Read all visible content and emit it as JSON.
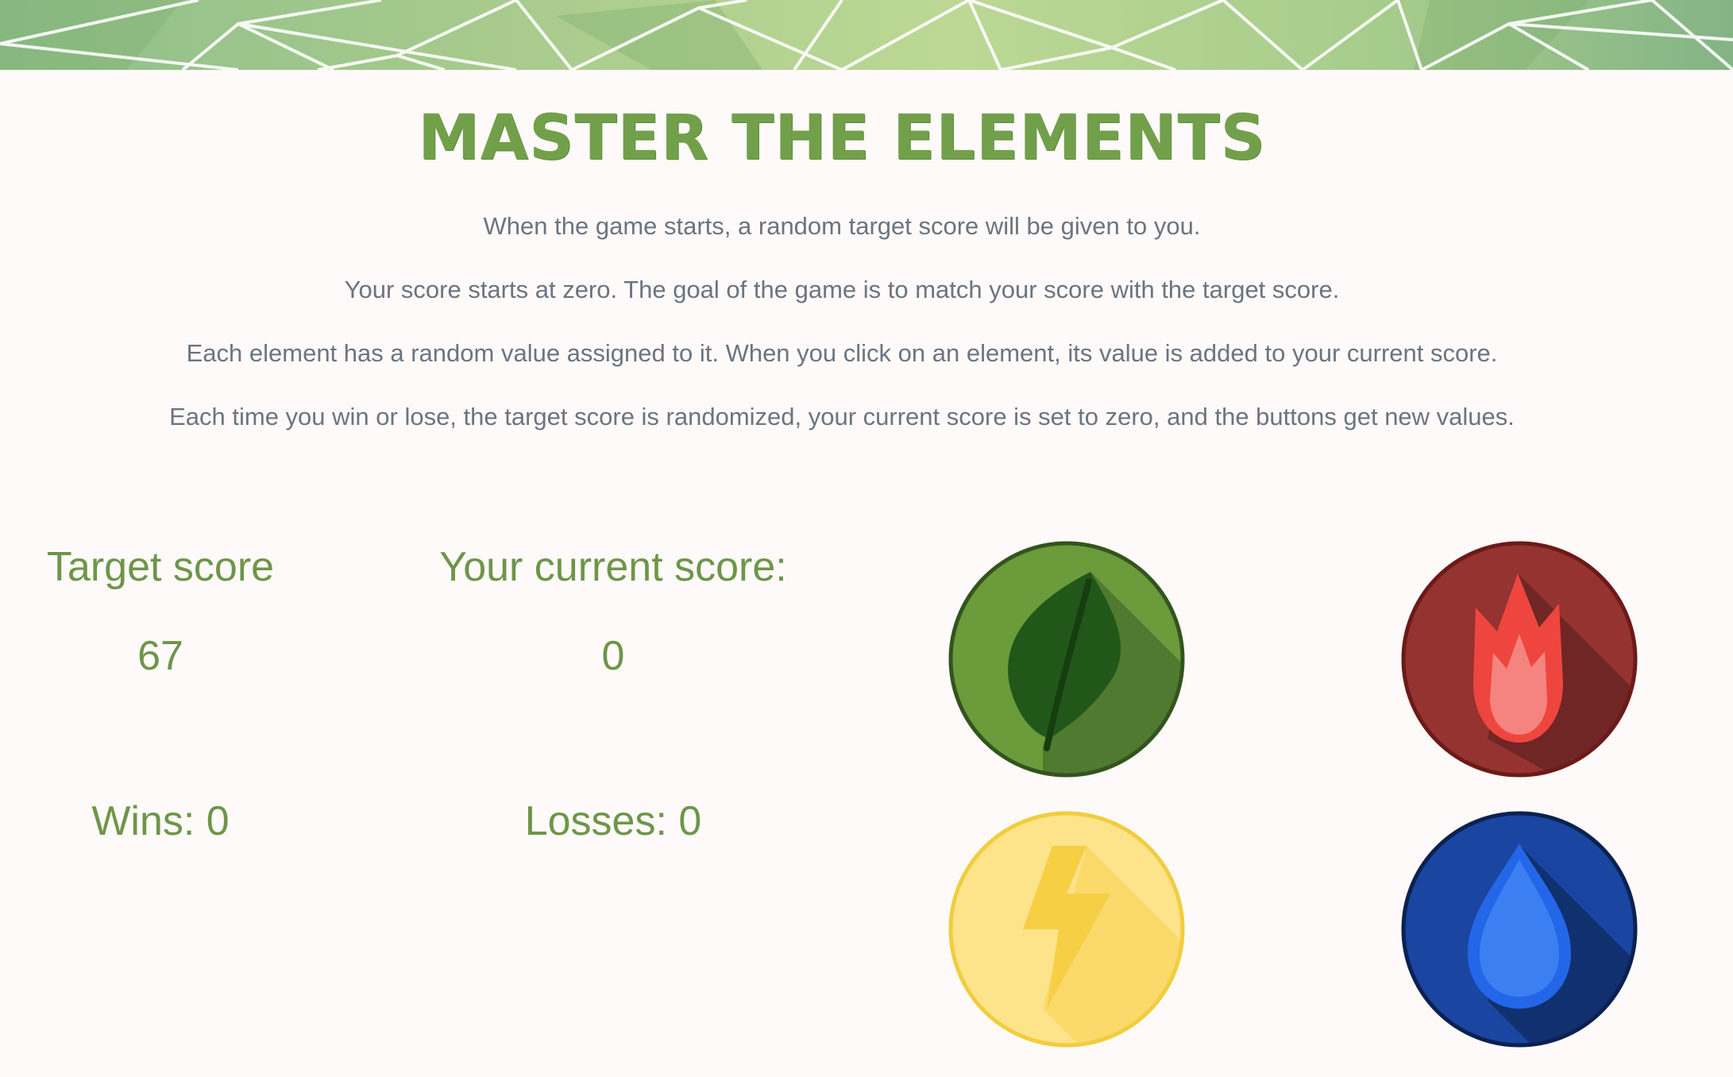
{
  "header": {
    "title": "MASTER THE ELEMENTS"
  },
  "instructions": [
    "When the game starts, a random target score will be given to you.",
    "Your score starts at zero. The goal of the game is to match your score with the target score.",
    "Each element has a random value assigned to it. When you click on an element, its value is added to your current score.",
    "Each time you win or lose, the target score is randomized, your current score is set to zero, and the buttons get new values."
  ],
  "scoreboard": {
    "target_label": "Target score",
    "target_value": "67",
    "current_label": "Your current score:",
    "current_value": "0",
    "wins_text": "Wins: 0",
    "losses_text": "Losses: 0"
  },
  "elements": [
    {
      "name": "earth",
      "icon": "leaf-icon",
      "color": "#6b9b3a"
    },
    {
      "name": "fire",
      "icon": "flame-icon",
      "color": "#943330"
    },
    {
      "name": "lightning",
      "icon": "lightning-bolt-icon",
      "color": "#fde38a"
    },
    {
      "name": "water",
      "icon": "water-drop-icon",
      "color": "#1a45a0"
    }
  ],
  "colors": {
    "accent_green": "#72a04a",
    "text_gray": "#6c7480",
    "background": "#fdfaf9"
  }
}
